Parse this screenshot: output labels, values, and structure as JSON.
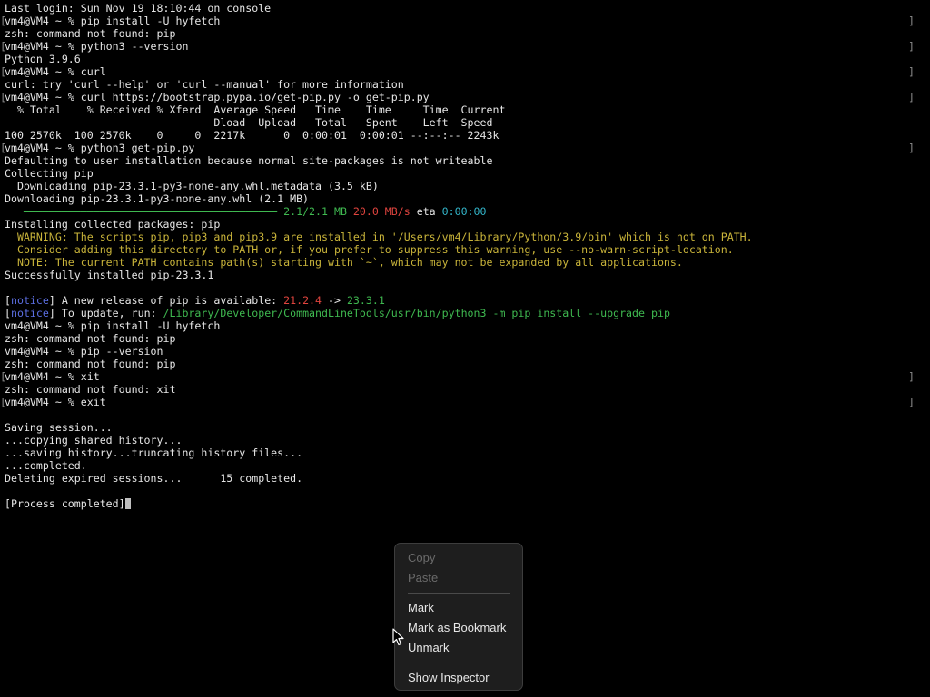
{
  "terminal": {
    "lines": [
      {
        "prompt": false,
        "segments": [
          {
            "text": "Last login: Sun Nov 19 18:10:44 on console",
            "color": "#e6e6e6"
          }
        ]
      },
      {
        "prompt": true,
        "segments": [
          {
            "text": "vm4@VM4 ~ % pip install -U hyfetch",
            "color": "#e6e6e6"
          }
        ]
      },
      {
        "prompt": false,
        "segments": [
          {
            "text": "zsh: command not found: pip",
            "color": "#e6e6e6"
          }
        ]
      },
      {
        "prompt": true,
        "segments": [
          {
            "text": "vm4@VM4 ~ % python3 --version",
            "color": "#e6e6e6"
          }
        ]
      },
      {
        "prompt": false,
        "segments": [
          {
            "text": "Python 3.9.6",
            "color": "#e6e6e6"
          }
        ]
      },
      {
        "prompt": true,
        "segments": [
          {
            "text": "vm4@VM4 ~ % curl",
            "color": "#e6e6e6"
          }
        ]
      },
      {
        "prompt": false,
        "segments": [
          {
            "text": "curl: try 'curl --help' or 'curl --manual' for more information",
            "color": "#e6e6e6"
          }
        ]
      },
      {
        "prompt": true,
        "segments": [
          {
            "text": "vm4@VM4 ~ % curl https://bootstrap.pypa.io/get-pip.py -o get-pip.py",
            "color": "#e6e6e6"
          }
        ]
      },
      {
        "prompt": false,
        "segments": [
          {
            "text": "  % Total    % Received % Xferd  Average Speed   Time    Time     Time  Current",
            "color": "#e6e6e6"
          }
        ]
      },
      {
        "prompt": false,
        "segments": [
          {
            "text": "                                 Dload  Upload   Total   Spent    Left  Speed",
            "color": "#e6e6e6"
          }
        ]
      },
      {
        "prompt": false,
        "segments": [
          {
            "text": "100 2570k  100 2570k    0     0  2217k      0  0:00:01  0:00:01 --:--:-- 2243k",
            "color": "#e6e6e6"
          }
        ]
      },
      {
        "prompt": true,
        "segments": [
          {
            "text": "vm4@VM4 ~ % python3 get-pip.py",
            "color": "#e6e6e6"
          }
        ]
      },
      {
        "prompt": false,
        "segments": [
          {
            "text": "Defaulting to user installation because normal site-packages is not writeable",
            "color": "#e6e6e6"
          }
        ]
      },
      {
        "prompt": false,
        "segments": [
          {
            "text": "Collecting pip",
            "color": "#e6e6e6"
          }
        ]
      },
      {
        "prompt": false,
        "segments": [
          {
            "text": "  Downloading pip-23.3.1-py3-none-any.whl.metadata (3.5 kB)",
            "color": "#e6e6e6"
          }
        ]
      },
      {
        "prompt": false,
        "segments": [
          {
            "text": "Downloading pip-23.3.1-py3-none-any.whl (2.1 MB)",
            "color": "#e6e6e6"
          }
        ]
      },
      {
        "prompt": false,
        "segments": [
          {
            "text": "   ━━━━━━━━━━━━━━━━━━━━━━━━━━━━━━━━━━━━━━━━ ",
            "color": "#3fb950"
          },
          {
            "text": "2.1/2.1 MB ",
            "color": "#3fb950"
          },
          {
            "text": "20.0 MB/s",
            "color": "#e0443e"
          },
          {
            "text": " eta ",
            "color": "#e6e6e6"
          },
          {
            "text": "0:00:00",
            "color": "#33b5c9"
          }
        ]
      },
      {
        "prompt": false,
        "segments": [
          {
            "text": "Installing collected packages: pip",
            "color": "#e6e6e6"
          }
        ]
      },
      {
        "prompt": false,
        "segments": [
          {
            "text": "  WARNING: The scripts pip, pip3 and pip3.9 are installed in '/Users/vm4/Library/Python/3.9/bin' which is not on PATH.",
            "color": "#c9b43a"
          }
        ]
      },
      {
        "prompt": false,
        "segments": [
          {
            "text": "  Consider adding this directory to PATH or, if you prefer to suppress this warning, use --no-warn-script-location.",
            "color": "#c9b43a"
          }
        ]
      },
      {
        "prompt": false,
        "segments": [
          {
            "text": "  NOTE: The current PATH contains path(s) starting with `~`, which may not be expanded by all applications.",
            "color": "#c9b43a"
          }
        ]
      },
      {
        "prompt": false,
        "segments": [
          {
            "text": "Successfully installed pip-23.3.1",
            "color": "#e6e6e6"
          }
        ]
      },
      {
        "prompt": false,
        "segments": [
          {
            "text": "",
            "color": "#e6e6e6"
          }
        ]
      },
      {
        "prompt": false,
        "segments": [
          {
            "text": "[",
            "color": "#e6e6e6"
          },
          {
            "text": "notice",
            "color": "#5b6ee1"
          },
          {
            "text": "] A new release of pip is available: ",
            "color": "#e6e6e6"
          },
          {
            "text": "21.2.4",
            "color": "#e0443e"
          },
          {
            "text": " -> ",
            "color": "#e6e6e6"
          },
          {
            "text": "23.3.1",
            "color": "#3fb950"
          }
        ]
      },
      {
        "prompt": false,
        "segments": [
          {
            "text": "[",
            "color": "#e6e6e6"
          },
          {
            "text": "notice",
            "color": "#5b6ee1"
          },
          {
            "text": "] To update, run: ",
            "color": "#e6e6e6"
          },
          {
            "text": "/Library/Developer/CommandLineTools/usr/bin/python3 -m pip install --upgrade pip",
            "color": "#3fb950"
          }
        ]
      },
      {
        "prompt": false,
        "segments": [
          {
            "text": "vm4@VM4 ~ % pip install -U hyfetch",
            "color": "#e6e6e6"
          }
        ]
      },
      {
        "prompt": false,
        "segments": [
          {
            "text": "zsh: command not found: pip",
            "color": "#e6e6e6"
          }
        ]
      },
      {
        "prompt": false,
        "segments": [
          {
            "text": "vm4@VM4 ~ % pip --version",
            "color": "#e6e6e6"
          }
        ]
      },
      {
        "prompt": false,
        "segments": [
          {
            "text": "zsh: command not found: pip",
            "color": "#e6e6e6"
          }
        ]
      },
      {
        "prompt": true,
        "segments": [
          {
            "text": "vm4@VM4 ~ % xit",
            "color": "#e6e6e6"
          }
        ]
      },
      {
        "prompt": false,
        "segments": [
          {
            "text": "zsh: command not found: xit",
            "color": "#e6e6e6"
          }
        ]
      },
      {
        "prompt": true,
        "segments": [
          {
            "text": "vm4@VM4 ~ % exit",
            "color": "#e6e6e6"
          }
        ]
      },
      {
        "prompt": false,
        "segments": [
          {
            "text": "",
            "color": "#e6e6e6"
          }
        ]
      },
      {
        "prompt": false,
        "segments": [
          {
            "text": "Saving session...",
            "color": "#e6e6e6"
          }
        ]
      },
      {
        "prompt": false,
        "segments": [
          {
            "text": "...copying shared history...",
            "color": "#e6e6e6"
          }
        ]
      },
      {
        "prompt": false,
        "segments": [
          {
            "text": "...saving history...truncating history files...",
            "color": "#e6e6e6"
          }
        ]
      },
      {
        "prompt": false,
        "segments": [
          {
            "text": "...completed.",
            "color": "#e6e6e6"
          }
        ]
      },
      {
        "prompt": false,
        "segments": [
          {
            "text": "Deleting expired sessions...      15 completed.",
            "color": "#e6e6e6"
          }
        ]
      },
      {
        "prompt": false,
        "segments": [
          {
            "text": "",
            "color": "#e6e6e6"
          }
        ]
      },
      {
        "prompt": false,
        "cursor": true,
        "segments": [
          {
            "text": "[Process completed]",
            "color": "#e6e6e6"
          }
        ]
      }
    ]
  },
  "context_menu": {
    "copy": "Copy",
    "paste": "Paste",
    "mark": "Mark",
    "mark_as_bookmark": "Mark as Bookmark",
    "unmark": "Unmark",
    "show_inspector": "Show Inspector"
  },
  "icons": {
    "pointer": "arrow-pointer-icon",
    "cursor": "text-cursor-block-icon"
  }
}
